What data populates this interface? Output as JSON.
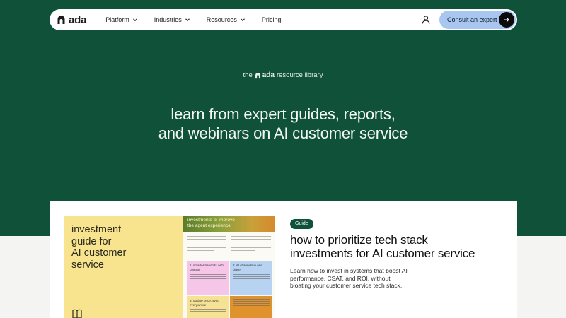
{
  "nav": {
    "logo_text": "ada",
    "items": [
      {
        "label": "Platform",
        "has_dropdown": true
      },
      {
        "label": "Industries",
        "has_dropdown": true
      },
      {
        "label": "Resources",
        "has_dropdown": true
      },
      {
        "label": "Pricing",
        "has_dropdown": false
      }
    ],
    "account_icon": "user-icon",
    "cta_label": "Consult an expert",
    "cta_icon": "arrow-right-icon"
  },
  "hero": {
    "tagline_prefix": "the",
    "tagline_logo": "ada",
    "tagline_suffix": "resource library",
    "headline_line1": "learn from expert guides, reports,",
    "headline_line2": "and webinars on AI customer service"
  },
  "card": {
    "cover": {
      "title_line1": "investment",
      "title_line2": "guide for",
      "title_line3": "AI customer",
      "title_line4": "service",
      "banner_line1": "investments to improve",
      "banner_line2": "the agent experience",
      "tile1": "1. smarter handoffs with context",
      "tile2": "2. AI channels in one place",
      "tile3": "3. update once, sync everywhere",
      "icon": "book-icon"
    },
    "badge": "Guide",
    "title_line1": "how to prioritize tech stack",
    "title_line2": "investments for AI customer service",
    "description_line1": "Learn how to invest in systems that boost AI",
    "description_line2": "performance, CSAT, and ROI, without",
    "description_line3": "bloating your customer service tech stack."
  },
  "colors": {
    "hero_bg": "#0f5139",
    "cta_bg": "#a9c6f0",
    "cover_yellow": "#f8e48f",
    "badge_bg": "#0f5139"
  }
}
